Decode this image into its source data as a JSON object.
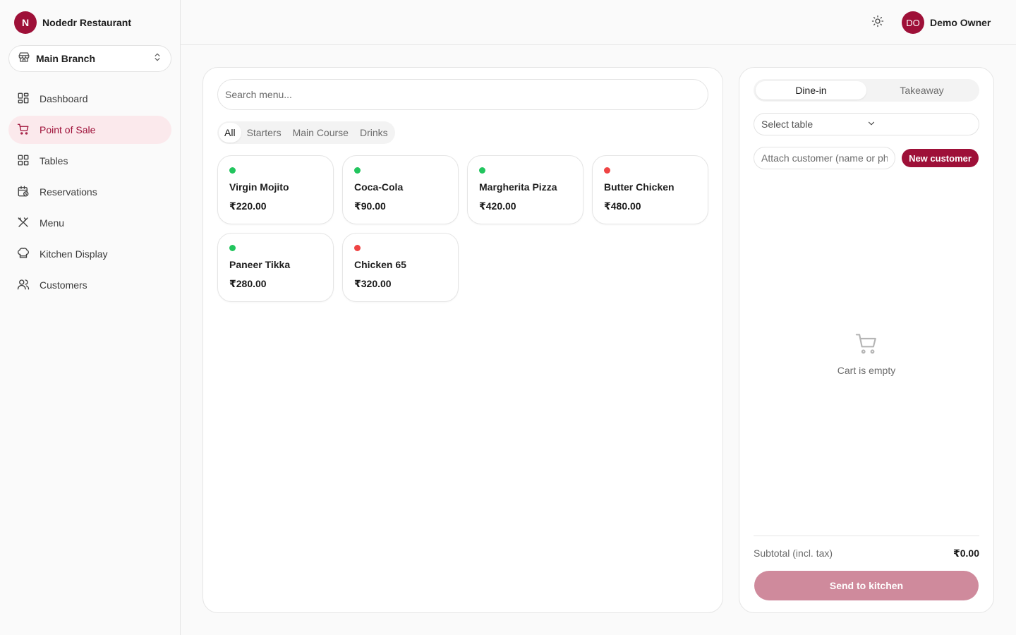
{
  "brand": {
    "logo_letter": "N",
    "name": "Nodedr Restaurant"
  },
  "branch": {
    "label": "Main Branch"
  },
  "nav": {
    "items": [
      {
        "label": "Dashboard"
      },
      {
        "label": "Point of Sale"
      },
      {
        "label": "Tables"
      },
      {
        "label": "Reservations"
      },
      {
        "label": "Menu"
      },
      {
        "label": "Kitchen Display"
      },
      {
        "label": "Customers"
      }
    ]
  },
  "header": {
    "user_initials": "DO",
    "user_name": "Demo Owner"
  },
  "menu": {
    "search_placeholder": "Search menu...",
    "categories": [
      "All",
      "Starters",
      "Main Course",
      "Drinks"
    ],
    "items": [
      {
        "name": "Virgin Mojito",
        "price": "₹220.00",
        "diet": "veg"
      },
      {
        "name": "Coca-Cola",
        "price": "₹90.00",
        "diet": "veg"
      },
      {
        "name": "Margherita Pizza",
        "price": "₹420.00",
        "diet": "veg"
      },
      {
        "name": "Butter Chicken",
        "price": "₹480.00",
        "diet": "non-veg"
      },
      {
        "name": "Paneer Tikka",
        "price": "₹280.00",
        "diet": "veg"
      },
      {
        "name": "Chicken 65",
        "price": "₹320.00",
        "diet": "non-veg"
      }
    ]
  },
  "cart": {
    "order_types": [
      "Dine-in",
      "Takeaway"
    ],
    "table_placeholder": "Select table",
    "customer_placeholder": "Attach customer (name or phone)",
    "new_customer_label": "New customer",
    "empty_text": "Cart is empty",
    "subtotal_label": "Subtotal (incl. tax)",
    "subtotal_value": "₹0.00",
    "send_label": "Send to kitchen"
  },
  "colors": {
    "brand": "#9e1038",
    "veg": "#22c55e",
    "non_veg": "#ef4444",
    "active_nav_bg": "#fbe9ec",
    "disabled_button": "#cf8a9c"
  }
}
